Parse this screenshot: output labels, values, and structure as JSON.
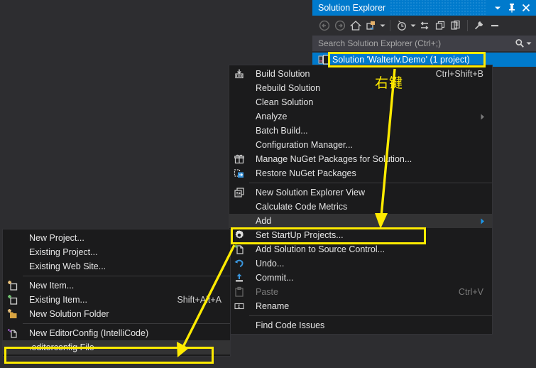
{
  "app": {
    "background_color": "#2d2d30",
    "accent_color": "#007acc",
    "menu_background": "#1b1b1c",
    "highlight_color": "#ffeb00"
  },
  "solution_explorer": {
    "title": "Solution Explorer",
    "title_buttons": [
      {
        "name": "dropdown",
        "glyph": "▼"
      },
      {
        "name": "pin",
        "glyph": "⚔"
      },
      {
        "name": "close",
        "glyph": "✕"
      }
    ],
    "toolbar_icons": [
      "back-icon",
      "forward-icon",
      "home-icon",
      "pending-changes-filter-icon",
      "pending-changes-caret",
      "toggle-preview-icon",
      "toggle-preview-caret",
      "sync-with-active-document-icon",
      "refresh-icon",
      "show-all-files-icon",
      "properties-icon",
      "collapse-all-icon"
    ],
    "search": {
      "placeholder": "Search Solution Explorer (Ctrl+;)",
      "icon": "search-icon",
      "caret": "▾"
    },
    "selected_node": {
      "label": "Solution 'Walterlv.Demo' (1 project)",
      "icon": "solution-icon",
      "selected": true
    }
  },
  "context_menu": {
    "items": [
      {
        "label": "Build Solution",
        "shortcut": "Ctrl+Shift+B",
        "icon": "build-solution-icon",
        "arrow": false,
        "disabled": false,
        "highlight": false
      },
      {
        "label": "Rebuild Solution",
        "shortcut": "",
        "icon": "",
        "arrow": false,
        "disabled": false,
        "highlight": false
      },
      {
        "label": "Clean Solution",
        "shortcut": "",
        "icon": "",
        "arrow": false,
        "disabled": false,
        "highlight": false
      },
      {
        "label": "Analyze",
        "shortcut": "",
        "icon": "",
        "arrow": true,
        "disabled": false,
        "highlight": false
      },
      {
        "label": "Batch Build...",
        "shortcut": "",
        "icon": "",
        "arrow": false,
        "disabled": false,
        "highlight": false
      },
      {
        "label": "Configuration Manager...",
        "shortcut": "",
        "icon": "",
        "arrow": false,
        "disabled": false,
        "highlight": false
      },
      {
        "label": "Manage NuGet Packages for Solution...",
        "shortcut": "",
        "icon": "nuget-icon",
        "arrow": false,
        "disabled": false,
        "highlight": false
      },
      {
        "label": "Restore NuGet Packages",
        "shortcut": "",
        "icon": "restore-nuget-icon",
        "arrow": false,
        "disabled": false,
        "highlight": false
      },
      {
        "separator": true
      },
      {
        "label": "New Solution Explorer View",
        "shortcut": "",
        "icon": "new-view-icon",
        "arrow": false,
        "disabled": false,
        "highlight": false
      },
      {
        "label": "Calculate Code Metrics",
        "shortcut": "",
        "icon": "",
        "arrow": false,
        "disabled": false,
        "highlight": false
      },
      {
        "label": "Add",
        "shortcut": "",
        "icon": "",
        "arrow": true,
        "disabled": false,
        "highlight": true
      },
      {
        "label": "Set StartUp Projects...",
        "shortcut": "",
        "icon": "gear-icon",
        "arrow": false,
        "disabled": false,
        "highlight": false
      },
      {
        "label": "Add Solution to Source Control...",
        "shortcut": "",
        "icon": "add-source-control-icon",
        "arrow": false,
        "disabled": false,
        "highlight": false
      },
      {
        "label": "Undo...",
        "shortcut": "",
        "icon": "undo-icon",
        "arrow": false,
        "disabled": false,
        "highlight": false
      },
      {
        "label": "Commit...",
        "shortcut": "",
        "icon": "commit-icon",
        "arrow": false,
        "disabled": false,
        "highlight": false
      },
      {
        "label": "Paste",
        "shortcut": "Ctrl+V",
        "icon": "paste-icon",
        "arrow": false,
        "disabled": true,
        "highlight": false
      },
      {
        "label": "Rename",
        "shortcut": "",
        "icon": "rename-icon",
        "arrow": false,
        "disabled": false,
        "highlight": false
      },
      {
        "separator": true
      },
      {
        "label": "Find Code Issues",
        "shortcut": "",
        "icon": "",
        "arrow": false,
        "disabled": false,
        "highlight": false
      }
    ]
  },
  "add_submenu": {
    "items": [
      {
        "label": "New Project...",
        "shortcut": "",
        "icon": "",
        "disabled": false,
        "highlight": false
      },
      {
        "label": "Existing Project...",
        "shortcut": "",
        "icon": "",
        "disabled": false,
        "highlight": false
      },
      {
        "label": "Existing Web Site...",
        "shortcut": "",
        "icon": "",
        "disabled": false,
        "highlight": false
      },
      {
        "separator": true
      },
      {
        "label": "New Item...",
        "shortcut": "",
        "icon": "new-item-icon",
        "disabled": false,
        "highlight": false
      },
      {
        "label": "Existing Item...",
        "shortcut": "Shift+Alt+A",
        "icon": "existing-item-icon",
        "disabled": false,
        "highlight": false
      },
      {
        "label": "New Solution Folder",
        "shortcut": "",
        "icon": "new-solution-folder-icon",
        "disabled": false,
        "highlight": false
      },
      {
        "separator": true
      },
      {
        "label": "New EditorConfig (IntelliCode)",
        "shortcut": "",
        "icon": "new-editorconfig-icon",
        "disabled": false,
        "highlight": false
      },
      {
        "label": ".editorconfig File",
        "shortcut": "",
        "icon": "",
        "disabled": false,
        "highlight": true
      }
    ]
  },
  "annotations": {
    "right_click_label": "右键",
    "highlight_boxes": [
      {
        "name": "solution-node-highlight"
      },
      {
        "name": "add-item-highlight"
      },
      {
        "name": "editorconfig-item-highlight"
      }
    ],
    "arrows": [
      {
        "name": "arrow-to-add",
        "from": "solution-node",
        "to": "add-menu-item"
      },
      {
        "name": "arrow-to-editorconfig",
        "from": "add-menu-item",
        "to": "editorconfig-file-item"
      }
    ]
  }
}
